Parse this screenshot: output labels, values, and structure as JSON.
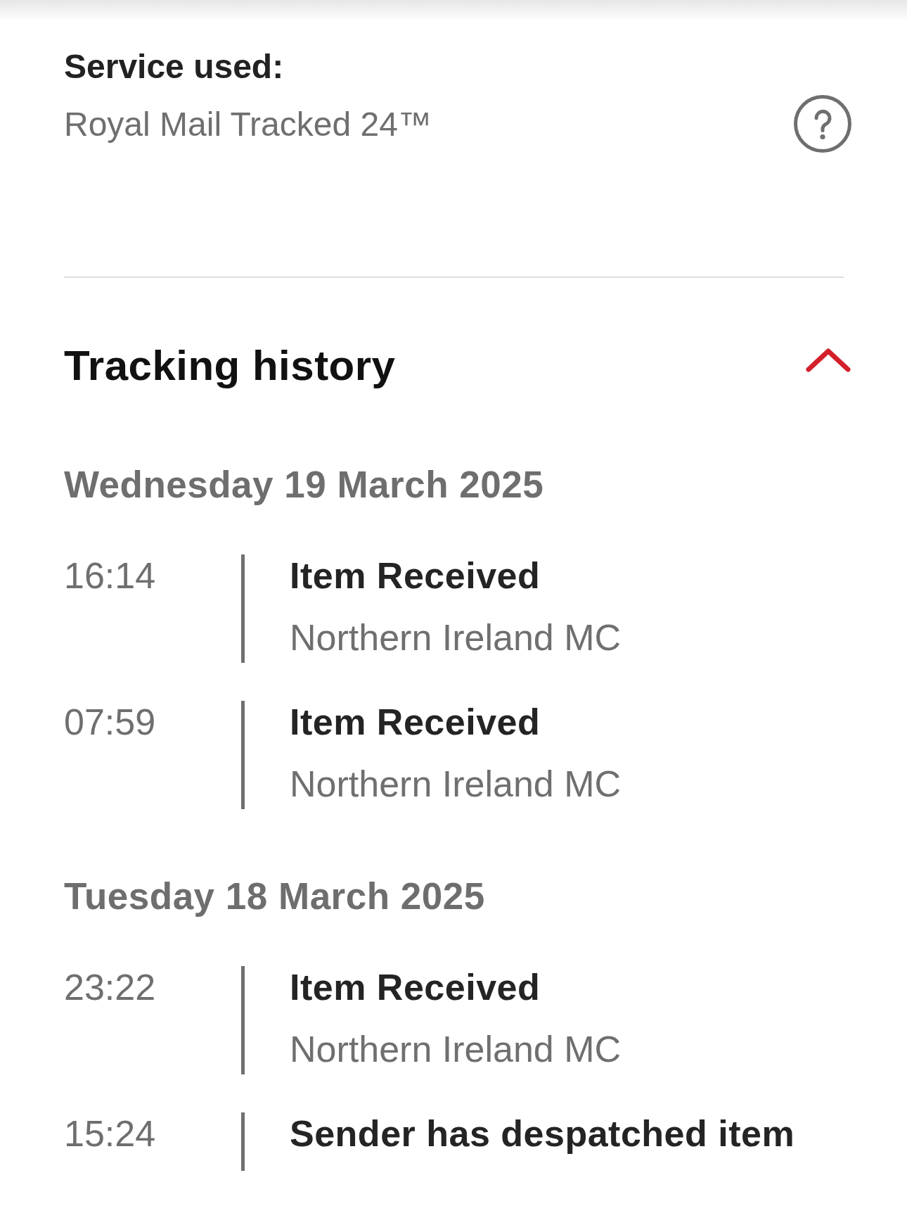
{
  "service": {
    "label": "Service used:",
    "value": "Royal Mail Tracked 24™"
  },
  "tracking_history": {
    "title": "Tracking history",
    "expanded": true,
    "days": [
      {
        "date": "Wednesday 19 March 2025",
        "events": [
          {
            "time": "16:14",
            "status": "Item Received",
            "location": "Northern Ireland MC"
          },
          {
            "time": "07:59",
            "status": "Item Received",
            "location": "Northern Ireland MC"
          }
        ]
      },
      {
        "date": "Tuesday 18 March 2025",
        "events": [
          {
            "time": "23:22",
            "status": "Item Received",
            "location": "Northern Ireland MC"
          },
          {
            "time": "15:24",
            "status": "Sender has despatched item"
          }
        ]
      }
    ]
  }
}
